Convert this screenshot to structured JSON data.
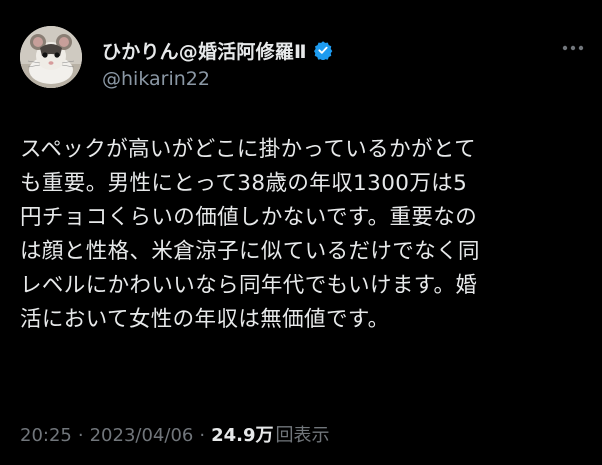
{
  "author": {
    "display_name": "ひかりん@婚活阿修羅Ⅱ",
    "handle": "@hikarin22",
    "verified_icon": "verified-badge-icon",
    "verified_color": "#1d9bf0"
  },
  "tweet": {
    "lines": [
      "スペックが高いがどこに掛かっているかがとて",
      "も重要。男性にとって38歳の年収1300万は5",
      "円チョコくらいの価値しかないです。重要なの",
      "は顔と性格、米倉涼子に似ているだけでなく同",
      "レベルにかわいいなら同年代でもいけます。婚",
      "活において女性の年収は無価値です。"
    ]
  },
  "meta": {
    "time": "20:25",
    "date": "2023/04/06",
    "separator": "·",
    "views_count": "24.9万",
    "views_label": "回表示"
  },
  "icons": {
    "more": "more-options-icon",
    "avatar": "avatar-rat-photo"
  },
  "colors": {
    "background": "#000000",
    "text": "#e7e9ea",
    "secondary": "#71767b"
  }
}
